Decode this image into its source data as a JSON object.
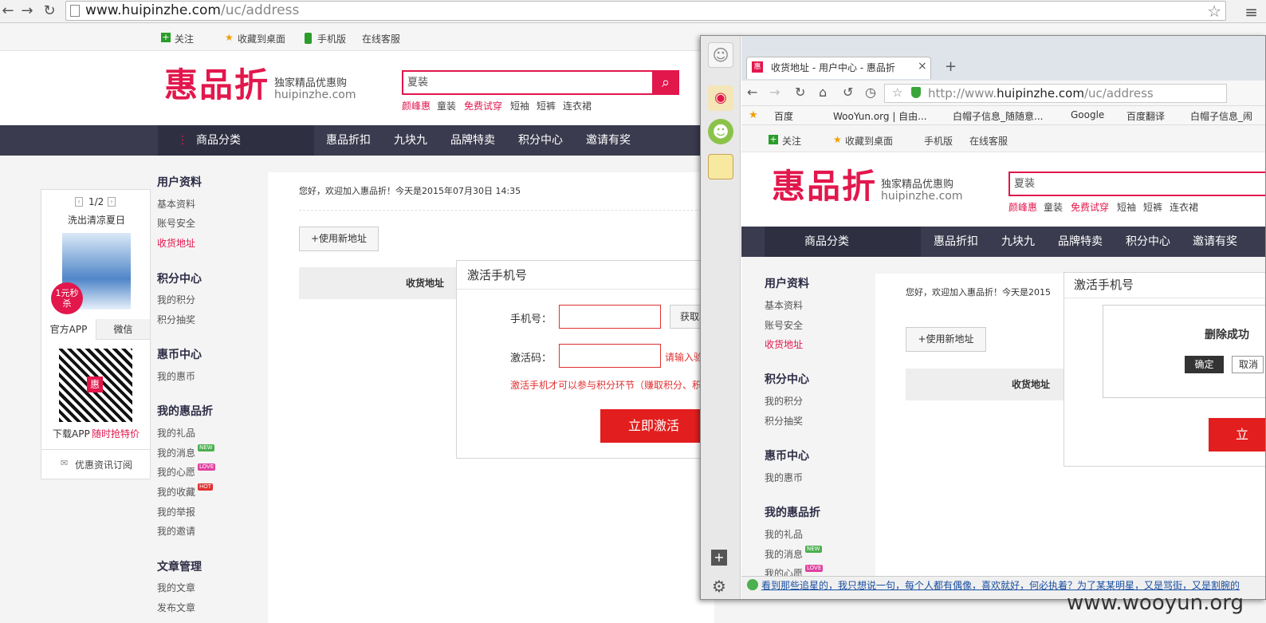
{
  "browser": {
    "url_host": "www.huipinzhe.com",
    "url_path": "/uc/address"
  },
  "topbar": {
    "follow": "关注",
    "fav": "收藏到桌面",
    "mobile": "手机版",
    "service": "在线客服"
  },
  "brand": {
    "logo": "惠品折",
    "tagline": "独家精品优惠购",
    "domain": "huipinzhe.com"
  },
  "search": {
    "value": "夏装",
    "hot": [
      "颜峰惠",
      "童装",
      "免费试穿",
      "短袖",
      "短裤",
      "连衣裙"
    ]
  },
  "nav": {
    "category": "商品分类",
    "items": [
      "惠品折扣",
      "九块九",
      "品牌特卖",
      "积分中心",
      "邀请有奖"
    ]
  },
  "sidebar": {
    "user_title": "用户资料",
    "user_items": [
      "基本资料",
      "账号安全",
      "收货地址"
    ],
    "points_title": "积分中心",
    "points_items": [
      "我的积分",
      "积分抽奖"
    ],
    "coin_title": "惠币中心",
    "coin_items": [
      "我的惠币"
    ],
    "mine_title": "我的惠品折",
    "mine_items": [
      "我的礼品",
      "我的消息",
      "我的心愿",
      "我的收藏",
      "我的举报",
      "我的邀请"
    ],
    "article_title": "文章管理",
    "article_items": [
      "我的文章",
      "发布文章"
    ],
    "badges": {
      "new": "NEW",
      "love": "LOVE",
      "hot": "HOT"
    }
  },
  "promo": {
    "pager": "1/2",
    "title": "洗出清凉夏日",
    "flash": "1元秒杀",
    "tab_app": "官方APP",
    "tab_wx": "微信",
    "qr_center": "惠",
    "download": "下载APP",
    "download_red": "随时抢特价",
    "subscribe": "优惠资讯订阅"
  },
  "main": {
    "welcome": "您好，欢迎加入惠品折！今天是2015年07月30日 14:35",
    "new_address": "+使用新地址",
    "col_address": "收货地址"
  },
  "modal": {
    "title": "激活手机号",
    "phone_label": "手机号：",
    "get_code": "获取验证码",
    "code_label": "激活码：",
    "code_hint": "请输入验证码",
    "note": "激活手机才可以参与积分环节（赚取积分、积分兑换等）",
    "submit": "立即激活"
  },
  "win2": {
    "tab_title": "收货地址 - 用户中心 - 惠品折",
    "url_prefix": "http://www.",
    "url_host": "huipinzhe.com",
    "url_path": "/uc/address",
    "bookmarks": [
      "百度",
      "WooYun.org | 自由...",
      "白帽子信息_随随意...",
      "Google",
      "百度翻译",
      "白帽子信息_闹"
    ],
    "welcome": "您好，欢迎加入惠品折！今天是2015",
    "dialog_msg": "删除成功",
    "ok": "确定",
    "cancel": "取消",
    "submit_part": "立",
    "status_text": "看到那些追星的，我只想说一句，每个人都有偶像，喜欢就好，何必执着？为了某某明星，又是骂街，又是割腕的"
  },
  "watermark": "www.wooyun.org"
}
